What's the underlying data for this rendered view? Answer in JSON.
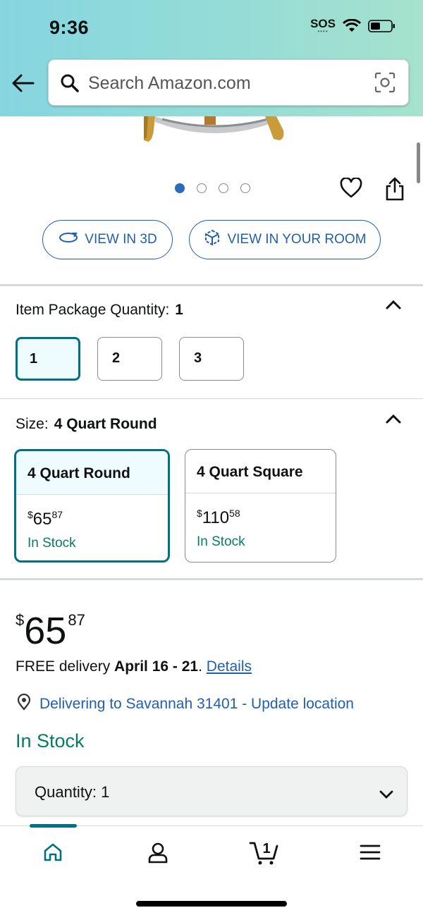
{
  "status_bar": {
    "time": "9:36",
    "sos": "SOS"
  },
  "search": {
    "placeholder": "Search Amazon.com"
  },
  "carousel": {
    "total": 4,
    "active_index": 0
  },
  "view_buttons": {
    "view_3d": "VIEW IN 3D",
    "view_room": "VIEW IN YOUR ROOM"
  },
  "package_quantity": {
    "label": "Item Package Quantity:",
    "selected": "1",
    "options": [
      "1",
      "2",
      "3"
    ]
  },
  "size": {
    "label": "Size:",
    "selected": "4 Quart Round",
    "options": [
      {
        "name": "4 Quart Round",
        "price_currency": "$",
        "price_whole": "65",
        "price_fraction": "87",
        "stock": "In Stock"
      },
      {
        "name": "4 Quart Square",
        "price_currency": "$",
        "price_whole": "110",
        "price_fraction": "58",
        "stock": "In Stock"
      }
    ]
  },
  "price": {
    "currency": "$",
    "whole": "65",
    "fraction": "87"
  },
  "delivery": {
    "prefix": "FREE delivery",
    "dates": "April 16 - 21",
    "separator": ".",
    "details_link": "Details"
  },
  "location": {
    "text": "Delivering to Savannah 31401 - Update location"
  },
  "availability": "In Stock",
  "quantity_select": {
    "label": "Quantity:",
    "value": "1"
  },
  "bottom_nav": {
    "cart_count": "1"
  },
  "colors": {
    "teal": "#007185",
    "link": "#1f5fb0",
    "stock_green": "#067d62"
  }
}
